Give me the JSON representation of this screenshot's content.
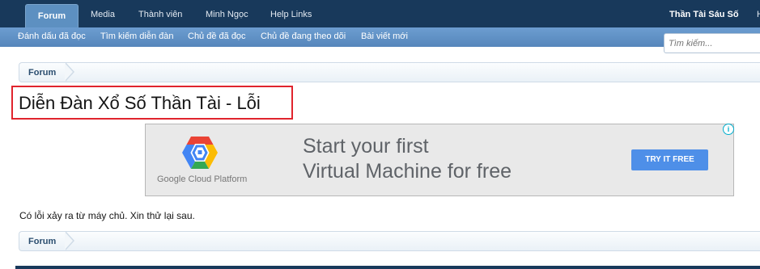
{
  "topnav": {
    "tabs": [
      {
        "label": "Forum",
        "active": true
      },
      {
        "label": "Media"
      },
      {
        "label": "Thành viên"
      },
      {
        "label": "Minh Ngọc"
      },
      {
        "label": "Help Links"
      }
    ],
    "user_label": "Thần Tài Sáu Số",
    "truncated_label": "H"
  },
  "subnav": {
    "links": [
      {
        "label": "Đánh dấu đã đọc"
      },
      {
        "label": "Tìm kiếm diễn đàn"
      },
      {
        "label": "Chủ đề đã đọc"
      },
      {
        "label": "Chủ đề đang theo dõi"
      },
      {
        "label": "Bài viết mới"
      }
    ]
  },
  "search": {
    "placeholder": "Tìm kiếm..."
  },
  "breadcrumb_top": {
    "label": "Forum"
  },
  "breadcrumb_bottom": {
    "label": "Forum"
  },
  "page_title": "Diễn Đàn Xổ Số Thần Tài - Lỗi",
  "ad": {
    "headline_line1": "Start your first",
    "headline_line2": "Virtual Machine for free",
    "brand": "Google Cloud Platform",
    "cta": "TRY IT FREE",
    "info_icon": "i"
  },
  "error_message": "Có lỗi xảy ra từ máy chủ. Xin thử lại sau.",
  "colors": {
    "nav_dark": "#18395b",
    "nav_tab_active": "#5d90c1",
    "subnav": "#6c9dd0",
    "title_highlight": "#e0242d",
    "ad_button": "#4e8fe8"
  }
}
